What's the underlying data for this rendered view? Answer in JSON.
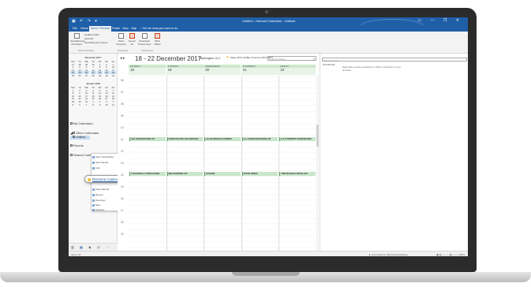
{
  "window": {
    "title": "Untitled - Hotmail Calendars - Outlook",
    "quick_access": "▣ ↶ ↷ ▾",
    "controls": "▭ — ❐ ✕"
  },
  "tabs": [
    {
      "label": "File"
    },
    {
      "label": "Home"
    },
    {
      "label": "Send / Receive"
    },
    {
      "label": "Folder"
    },
    {
      "label": "View"
    },
    {
      "label": "Help"
    },
    {
      "label": "♀ Tell me what you want to do"
    }
  ],
  "ribbon": {
    "send_receive_all": "Send/Receive All Folders",
    "update_folder": "Update Folder",
    "send_all": "Send All",
    "send_receive_groups": "Send/Receive Groups",
    "show_progress": "Show Progress",
    "cancel_all": "Cancel All",
    "download_prefs": "Download Preferences",
    "work_offline": "Work Offline",
    "group_send_receive": "Send & Receive",
    "group_download": "Download",
    "group_prefs": "Preferences"
  },
  "mini_calendars": [
    {
      "title": "December 2017",
      "weekdays": [
        "MO",
        "TU",
        "WE",
        "TH",
        "FR",
        "SA",
        "SU"
      ],
      "rows": [
        [
          "27",
          "28",
          "29",
          "30",
          "1",
          "2",
          "3"
        ],
        [
          "4",
          "5",
          "6",
          "7",
          "8",
          "9",
          "10"
        ],
        [
          "11",
          "12",
          "13",
          "14",
          "15",
          "16",
          "17"
        ],
        [
          "18",
          "19",
          "20",
          "21",
          "22",
          "23",
          "24"
        ],
        [
          "25",
          "26",
          "27",
          "28",
          "29",
          "30",
          "31"
        ]
      ]
    },
    {
      "title": "January 2018",
      "weekdays": [
        "MO",
        "TU",
        "WE",
        "TH",
        "FR",
        "SA",
        "SU"
      ],
      "rows": [
        [
          "1",
          "2",
          "3",
          "4",
          "5",
          "6",
          "7"
        ],
        [
          "8",
          "9",
          "10",
          "11",
          "12",
          "13",
          "14"
        ],
        [
          "15",
          "16",
          "17",
          "18",
          "19",
          "20",
          "21"
        ],
        [
          "22",
          "23",
          "24",
          "25",
          "26",
          "27",
          "28"
        ],
        [
          "29",
          "30",
          "31",
          "1",
          "2",
          "3",
          "4"
        ],
        [
          "5",
          "6",
          "7",
          "8",
          "9",
          "10",
          "11"
        ]
      ]
    }
  ],
  "folders": {
    "my_calendars": "My Calendars",
    "other_calendars": "Other Calendars",
    "untitled": "Untitled",
    "rooms": "Rooms",
    "shared_calendars": "Shared Calendars"
  },
  "context_menu": [
    {
      "label": "Open in New Window"
    },
    {
      "label": "Open Calendar"
    },
    {
      "label": "Color"
    },
    {
      "label": "Delete Calendar"
    },
    {
      "label": "Move Up"
    },
    {
      "label": "Move Down"
    },
    {
      "label": "Share"
    },
    {
      "label": "Properties..."
    }
  ],
  "rename_label": "Rename Calendar",
  "navbar": {
    "mail": "▥",
    "calendar": "▦",
    "people": "♟",
    "tasks": "☑",
    "more": "···"
  },
  "calendar": {
    "date_range": "18 - 22 December 2017",
    "location": "Washington, D.C.",
    "today_label": "Today",
    "today_temp": "18°F/ 20°F",
    "tomorrow_label": "Tomorrow",
    "tomorrow_temp": "45°F/ 30°F",
    "search_placeholder": "Search Untitled",
    "weekdays": [
      "MONDAY",
      "TUESDAY",
      "WEDNESDAY",
      "THURSDAY",
      "FRIDAY"
    ],
    "days": [
      "18",
      "19",
      "20",
      "21",
      "22"
    ],
    "hours": [
      "06",
      "07",
      "08",
      "09",
      "10",
      "11",
      "12",
      "13",
      "14",
      "15",
      "16",
      "17",
      "18",
      "19"
    ],
    "events": [
      {
        "title": "C&E CONSTRUCTION LTD"
      },
      {
        "title": "COMPLETE DRILLING SERVICES"
      },
      {
        "title": "ALLAN BAKER PLASTERER"
      },
      {
        "title": "J & J BAKER (BUILDERS) LTD"
      },
      {
        "title": "D & S PROPERTY MAINTENANCE"
      },
      {
        "title": "LYN DAVIES & C PRICE DAVIES"
      },
      {
        "title": "NEIL BURROWS LTD"
      },
      {
        "title": "W EVANS"
      },
      {
        "title": "OFFRD HOMES"
      },
      {
        "title": "TREVOR BAILEY INSTALLER"
      }
    ]
  },
  "people_pane": {
    "search_placeholder": "Search People",
    "favorites": "FAVORITES",
    "message": "Right-click a person elsewhere in Office to add them to your favorites."
  },
  "status": {
    "items": "Items: 10",
    "connection": "▲ Connected to: Microsoft Exchange",
    "zoom": "▣ ▥ — ——▮—— + 100%"
  },
  "colors": {
    "brand": "#1f5fa8",
    "event_bg": "#c8e6c9",
    "selection": "#c5dcf2"
  }
}
